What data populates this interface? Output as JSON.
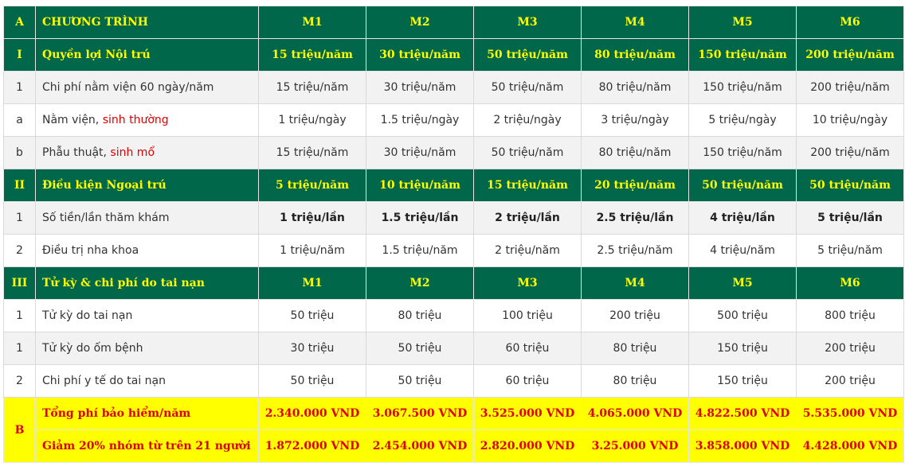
{
  "header": {
    "code": "A",
    "title": "CHƯƠNG TRÌNH",
    "plans": [
      "M1",
      "M2",
      "M3",
      "M4",
      "M5",
      "M6"
    ]
  },
  "section1": {
    "code": "I",
    "title": "Quyền lợi Nội trú",
    "values": [
      "15 triệu/năm",
      "30 triệu/năm",
      "50 triệu/năm",
      "80 triệu/năm",
      "150 triệu/năm",
      "200 triệu/năm"
    ],
    "rows": [
      {
        "code": "1",
        "label": "Chi phí nằm viện 60 ngày/năm",
        "label_red": "",
        "values": [
          "15 triệu/năm",
          "30 triệu/năm",
          "50 triệu/năm",
          "80 triệu/năm",
          "150 triệu/năm",
          "200 triệu/năm"
        ]
      },
      {
        "code": "a",
        "label": "Nằm viện, ",
        "label_red": "sinh thường",
        "values": [
          "1 triệu/ngày",
          "1.5 triệu/ngày",
          "2 triệu/ngày",
          "3 triệu/ngày",
          "5 triệu/ngày",
          "10 triệu/ngày"
        ]
      },
      {
        "code": "b",
        "label": "Phẫu thuật, ",
        "label_red": "sinh mổ",
        "values": [
          "15 triệu/năm",
          "30 triệu/năm",
          "50 triệu/năm",
          "80 triệu/năm",
          "150 triệu/năm",
          "200 triệu/năm"
        ]
      }
    ]
  },
  "section2": {
    "code": "II",
    "title": "Điều kiện Ngoại trú",
    "values": [
      "5 triệu/năm",
      "10 triệu/năm",
      "15 triệu/năm",
      "20 triệu/năm",
      "50 triệu/năm",
      "50 triệu/năm"
    ],
    "rows": [
      {
        "code": "1",
        "label": "Số tiền/lần thăm khám",
        "values": [
          "1 triệu/lần",
          "1.5 triệu/lần",
          "2 triệu/lần",
          "2.5 triệu/lần",
          "4 triệu/lần",
          "5 triệu/lần"
        ]
      },
      {
        "code": "2",
        "label": "Điều trị nha khoa",
        "values": [
          "1 triệu/năm",
          "1.5 triệu/năm",
          "2 triệu/năm",
          "2.5 triệu/năm",
          "4 triệu/năm",
          "5 triệu/năm"
        ]
      }
    ]
  },
  "section3": {
    "code": "III",
    "title": "Tử kỳ & chi phí do tai nạn",
    "values": [
      "M1",
      "M2",
      "M3",
      "M4",
      "M5",
      "M6"
    ],
    "rows": [
      {
        "code": "1",
        "label": "Tử kỳ do tai nạn",
        "values": [
          "50 triệu",
          "80 triệu",
          "100 triệu",
          "200 triệu",
          "500 triệu",
          "800 triệu"
        ]
      },
      {
        "code": "1",
        "label": "Tử kỳ do ốm bệnh",
        "values": [
          "30 triệu",
          "50 triệu",
          "60 triệu",
          "80 triệu",
          "150 triệu",
          "200 triệu"
        ]
      },
      {
        "code": "2",
        "label": "Chi phí y tế do tai nạn",
        "values": [
          "50 triệu",
          "50 triệu",
          "60 triệu",
          "80 triệu",
          "150 triệu",
          "200 triệu"
        ]
      }
    ]
  },
  "fees": {
    "code": "B",
    "total_label": "Tổng phí bảo hiểm/năm",
    "total_values": [
      "2.340.000 VND",
      "3.067.500 VND",
      "3.525.000 VND",
      "4.065.000 VND",
      "4.822.500 VND",
      "5.535.000 VND"
    ],
    "discount_label": "Giảm 20% nhóm từ trên 21 người",
    "discount_values": [
      "1.872.000 VND",
      "2.454.000 VND",
      "2.820.000 VND",
      "3.25.000 VND",
      "3.858.000 VND",
      "4.428.000 VND"
    ]
  }
}
